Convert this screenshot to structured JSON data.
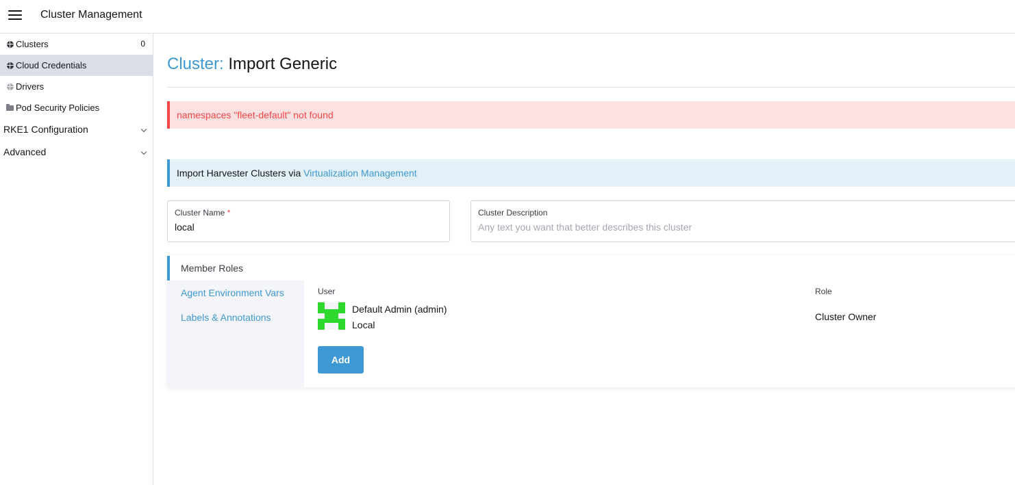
{
  "header": {
    "title": "Cluster Management",
    "menu_icon": "hamburger-menu-icon"
  },
  "sidebar": {
    "items": [
      {
        "label": "Clusters",
        "icon": "globe-icon",
        "count": "0"
      },
      {
        "label": "Cloud Credentials",
        "icon": "globe-icon",
        "active": true
      },
      {
        "label": "Drivers",
        "icon": "globe-icon"
      },
      {
        "label": "Pod Security Policies",
        "icon": "folder-icon"
      }
    ],
    "groups": [
      {
        "label": "RKE1 Configuration"
      },
      {
        "label": "Advanced"
      }
    ]
  },
  "page": {
    "title_prefix": "Cluster:",
    "title": "Import Generic"
  },
  "error_banner": {
    "text": "namespaces \"fleet-default\" not found"
  },
  "info_banner": {
    "text": "Import Harvester Clusters via ",
    "link": "Virtualization Management"
  },
  "form": {
    "name": {
      "label": "Cluster Name",
      "required": "*",
      "value": "local"
    },
    "description": {
      "label": "Cluster Description",
      "placeholder": "Any text you want that better describes this cluster"
    }
  },
  "tabs": [
    {
      "label": "Member Roles",
      "active": true
    },
    {
      "label": "Agent Environment Vars"
    },
    {
      "label": "Labels & Annotations"
    }
  ],
  "member_roles": {
    "user_header": "User",
    "role_header": "Role",
    "members": [
      {
        "name": "Default Admin (admin)",
        "provider": "Local",
        "role": "Cluster Owner"
      }
    ],
    "add_label": "Add"
  },
  "colors": {
    "accent": "#3d98d3",
    "error": "#f64747",
    "avatar": "#2ed82e"
  }
}
